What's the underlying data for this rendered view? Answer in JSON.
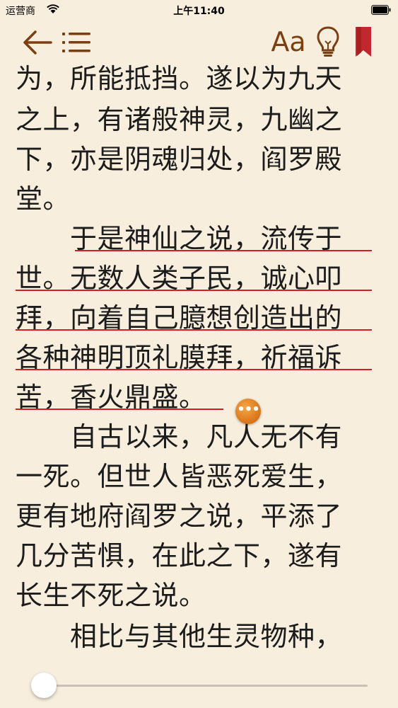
{
  "status_bar": {
    "carrier": "运营商",
    "time": "上午11:40"
  },
  "toolbar": {
    "back_icon": "back-arrow-icon",
    "toc_icon": "list-icon",
    "font_label": "Aa",
    "light_icon": "lightbulb-icon",
    "bookmark_icon": "bookmark-icon",
    "accent_color": "#7b3f12",
    "bookmark_color": "#c1272d"
  },
  "reader": {
    "lines": [
      "为，所能抵挡。遂以为九天",
      "之上，有诸般神灵，九幽之",
      "下，亦是阴魂归处，阎罗殿",
      "堂。",
      "　　于是神仙之说，流传于",
      "世。无数人类子民，诚心叩",
      "拜，向着自己臆想创造出的",
      "各种神明顶礼膜拜，祈福诉",
      "苦，香火鼎盛。",
      "　　自古以来，凡人无不有",
      "一死。但世人皆恶死爱生，",
      "更有地府阎罗之说，平添了",
      "几分苦惧，在此之下，遂有",
      "长生不死之说。",
      "　　相比与其他生灵物种，"
    ],
    "highlight_color": "#d02020",
    "note_button_icon": "ellipsis-icon"
  },
  "progress": {
    "value": 0.0
  }
}
